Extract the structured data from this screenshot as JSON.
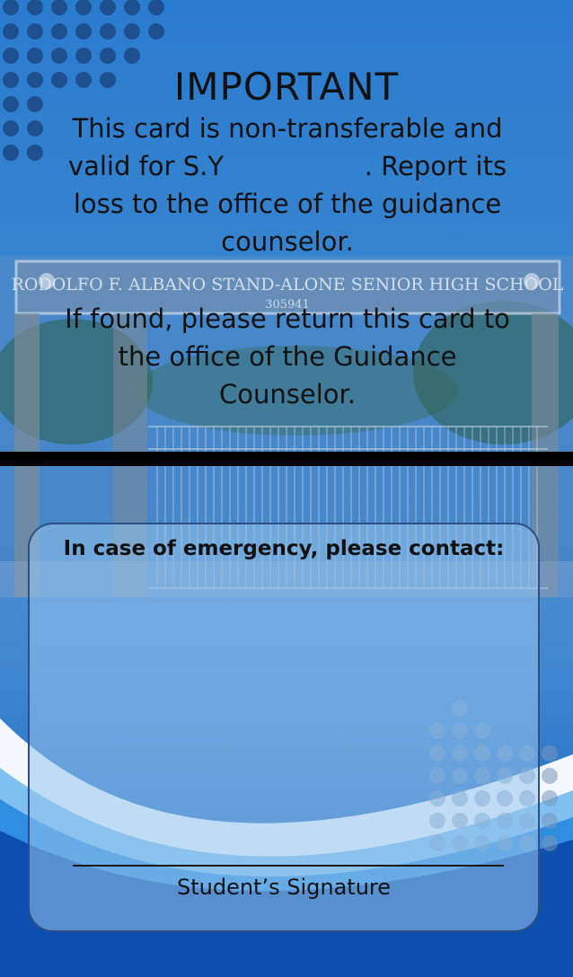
{
  "card": {
    "title": "IMPORTANT",
    "line1": "This card is non-transferable and valid for S.Y                 . Report its loss to the office of the guidance counselor.",
    "line2": "If found, please return this card to the office of the Guidance Counselor.",
    "photo_sign": "RODOLFO F. ALBANO STAND-ALONE SENIOR HIGH SCHOOL",
    "photo_code": "305941",
    "emergency_label": "In case of emergency, please contact:",
    "signature_label": "Student’s Signature"
  },
  "colors": {
    "background_top": "#2a7ccf",
    "background_bottom": "#0d4fae",
    "panel_border": "#2b4f86",
    "band": "#000000",
    "text": "#111111"
  }
}
